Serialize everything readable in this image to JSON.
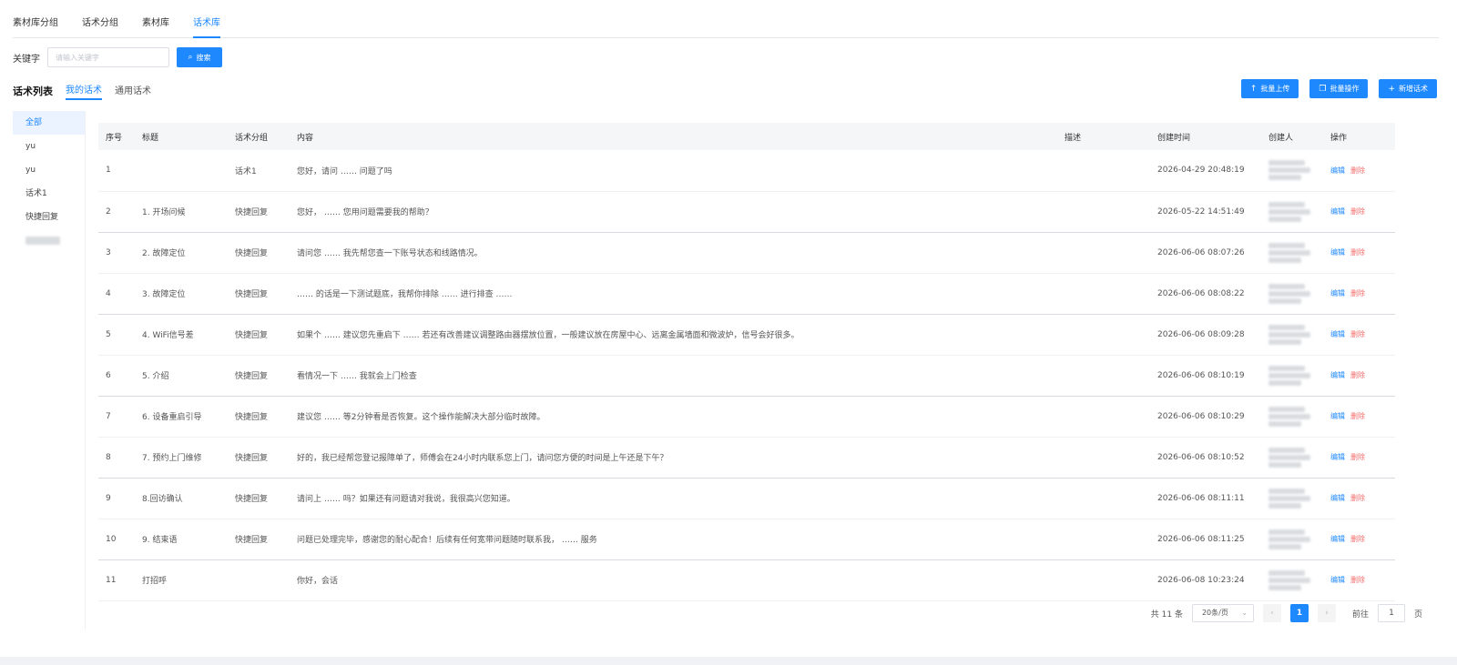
{
  "top_tabs": [
    {
      "label": "素材库分组"
    },
    {
      "label": "话术分组"
    },
    {
      "label": "素材库"
    },
    {
      "label": "话术库"
    }
  ],
  "search": {
    "label": "关键字",
    "placeholder": "请输入关键字",
    "button": "搜索"
  },
  "list": {
    "title": "话术列表",
    "tab_mine": "我的话术",
    "tab_common": "通用话术"
  },
  "actions": {
    "upload": "批量上传",
    "batch": "批量操作",
    "add": "新增话术"
  },
  "sidebar": [
    "全部",
    "yu",
    "yu",
    "话术1",
    "快捷回复"
  ],
  "table": {
    "headers": [
      "序号",
      "标题",
      "话术分组",
      "内容",
      "描述",
      "创建时间",
      "创建人",
      "操作"
    ],
    "rows": [
      {
        "no": "1",
        "title": "",
        "group": "话术1",
        "content": "您好，请问 …… 问题了吗",
        "time": "2026-04-29 20:48:19"
      },
      {
        "no": "2",
        "title": "1. 开场问候",
        "group": "快捷回复",
        "content": "您好， …… 您用问题需要我的帮助？",
        "time": "2026-05-22 14:51:49"
      },
      {
        "no": "3",
        "title": "2. 故障定位",
        "group": "快捷回复",
        "content": "请问您 …… 我先帮您查一下账号状态和线路情况。",
        "time": "2026-06-06 08:07:26"
      },
      {
        "no": "4",
        "title": "3. 故障定位",
        "group": "快捷回复",
        "content": "…… 的话是一下测试题底，我帮你排除 …… 进行排查 ……",
        "time": "2026-06-06 08:08:22"
      },
      {
        "no": "5",
        "title": "4. WiFi信号差",
        "group": "快捷回复",
        "content": "如果个 …… 建议您先重启下 …… 若还有改善建议调整路由器摆放位置，一般建议放在房屋中心、远离金属墙面和微波炉，信号会好很多。",
        "time": "2026-06-06 08:09:28"
      },
      {
        "no": "6",
        "title": "5. 介绍",
        "group": "快捷回复",
        "content": "看情况一下 …… 我就会上门检查",
        "time": "2026-06-06 08:10:19"
      },
      {
        "no": "7",
        "title": "6. 设备重启引导",
        "group": "快捷回复",
        "content": "建议您 …… 等2分钟看是否恢复。这个操作能解决大部分临时故障。",
        "time": "2026-06-06 08:10:29"
      },
      {
        "no": "8",
        "title": "7. 预约上门维修",
        "group": "快捷回复",
        "content": "好的，我已经帮您登记报障单了，师傅会在24小时内联系您上门，请问您方便的时间是上午还是下午？",
        "time": "2026-06-06 08:10:52"
      },
      {
        "no": "9",
        "title": "8.回访确认",
        "group": "快捷回复",
        "content": "请问上 …… 吗？如果还有问题请对我说，我很高兴您知道。",
        "time": "2026-06-06 08:11:11"
      },
      {
        "no": "10",
        "title": "9. 结束语",
        "group": "快捷回复",
        "content": "问题已处理完毕，感谢您的耐心配合！后续有任何宽带问题随时联系我， …… 服务",
        "time": "2026-06-06 08:11:25"
      },
      {
        "no": "11",
        "title": "打招呼",
        "group": "",
        "content": "你好，会话",
        "time": "2026-06-08 10:23:24"
      }
    ],
    "edit_label": "编辑",
    "delete_label": "删除"
  },
  "pagination": {
    "total": "共 11 条",
    "page_size": "20条/页",
    "current": "1",
    "goto_label": "前往",
    "goto_value": "1",
    "page_unit": "页"
  },
  "colors": {
    "accent": "#1e88ff",
    "danger": "#f56c6c"
  }
}
